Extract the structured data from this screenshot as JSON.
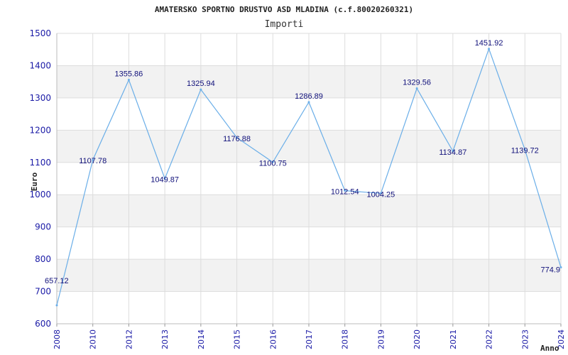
{
  "chart_data": {
    "type": "line",
    "title": "AMATERSKO SPORTNO DRUSTVO ASD MLADINA (c.f.80020260321)",
    "subtitle": "Importi",
    "xlabel": "Anno",
    "ylabel": "Euro",
    "ylim": [
      600,
      1500
    ],
    "yticks": [
      600,
      700,
      800,
      900,
      1000,
      1100,
      1200,
      1300,
      1400,
      1500
    ],
    "grid": true,
    "categories": [
      "2008",
      "2010",
      "2012",
      "2013",
      "2014",
      "2015",
      "2016",
      "2017",
      "2018",
      "2019",
      "2020",
      "2021",
      "2022",
      "2023",
      "2024"
    ],
    "series": [
      {
        "values": [
          657.12,
          1107.78,
          1355.86,
          1049.87,
          1325.94,
          1176.88,
          1100.75,
          1286.89,
          1012.54,
          1004.25,
          1329.56,
          1134.87,
          1451.92,
          1139.72,
          774.9
        ],
        "labels": [
          "657.12",
          "1107.78",
          "1355.86",
          "1049.87",
          "1325.94",
          "1176.88",
          "1100.75",
          "1286.89",
          "1012.54",
          "1004.25",
          "1329.56",
          "1134.87",
          "1451.92",
          "1139.72",
          "774.9"
        ]
      }
    ],
    "colors": {
      "line": "#6aaee8",
      "band": "#f2f2f2",
      "grid": "#dddddd",
      "tick_text": "#1a1aa6",
      "label_text": "#10107a"
    }
  }
}
